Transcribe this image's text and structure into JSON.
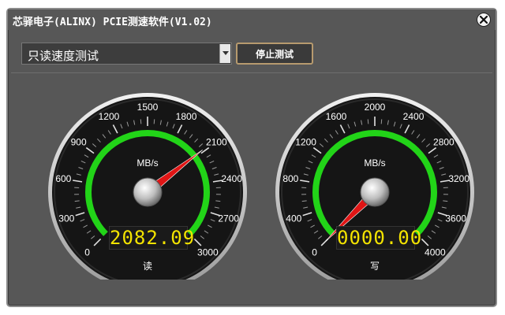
{
  "window": {
    "title": "芯驿电子(ALINX) PCIE测速软件(V1.02)"
  },
  "toolbar": {
    "mode_select_value": "只读速度测试",
    "stop_button_label": "停止测试"
  },
  "gauges": {
    "read": {
      "unit": "MB/s",
      "ticks": [
        "0",
        "300",
        "600",
        "900",
        "1200",
        "1500",
        "1800",
        "2100",
        "2400",
        "2700",
        "3000"
      ],
      "max": 3000,
      "value": 2082.09,
      "display": "2082.09",
      "label": "读"
    },
    "write": {
      "unit": "MB/s",
      "ticks": [
        "0",
        "400",
        "800",
        "1200",
        "1600",
        "2000",
        "2400",
        "2800",
        "3200",
        "3600",
        "4000"
      ],
      "max": 4000,
      "value": 0,
      "display": "0000.00",
      "label": "写"
    }
  },
  "colors": {
    "background": "#575757",
    "arc_green": "#22d418",
    "needle": "#e01515",
    "digit": "#f3e300"
  }
}
